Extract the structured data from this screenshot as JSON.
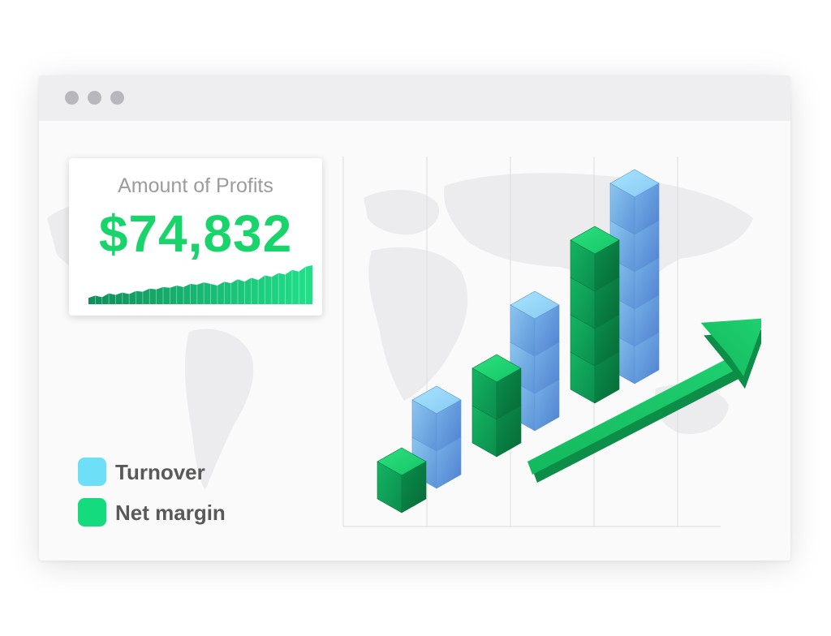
{
  "window": {
    "controls": [
      "close",
      "minimize",
      "maximize"
    ]
  },
  "card": {
    "title": "Amount of Profits",
    "value": "$74,832",
    "sparkline": [
      8,
      11,
      9,
      14,
      12,
      15,
      13,
      17,
      16,
      20,
      19,
      22,
      21,
      24,
      22,
      26,
      25,
      28,
      26,
      24,
      29,
      27,
      32,
      29,
      34,
      31,
      37,
      35,
      40,
      38,
      44,
      42,
      48,
      50
    ]
  },
  "legend": [
    {
      "label": "Turnover",
      "color": "#6de0f8"
    },
    {
      "label": "Net margin",
      "color": "#13db7e"
    }
  ],
  "chart_data": {
    "type": "bar",
    "categories": [
      "",
      "",
      "",
      ""
    ],
    "series": [
      {
        "name": "Turnover",
        "values": [
          2,
          3,
          5
        ]
      },
      {
        "name": "Net margin",
        "values": [
          1,
          2,
          4
        ]
      }
    ],
    "trend": "up",
    "colors": {
      "turnover": "#79b8ec",
      "net_margin": "#13c46c",
      "arrow": "#16c265"
    }
  }
}
